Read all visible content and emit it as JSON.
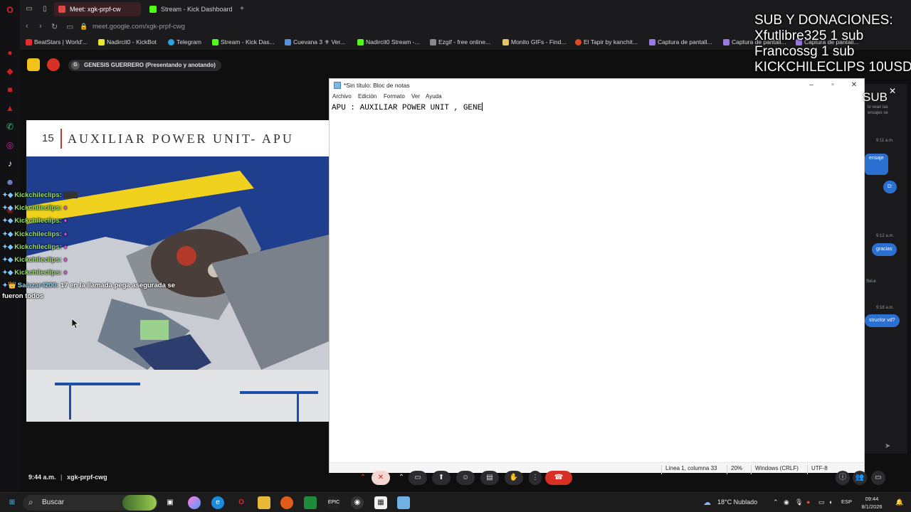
{
  "browser": {
    "tabs": [
      {
        "label": "Meet: xgk-prpf-cw",
        "active": true
      },
      {
        "label": "Stream - Kick Dashboard",
        "active": false
      }
    ],
    "url": "meet.google.com/xgk-prpf-cwg",
    "bookmarks": [
      "BeatStars | World'...",
      "Nadircit0 - KickBot",
      "Telegram",
      "Stream - Kick Das...",
      "Cuevana 3 ⚜ Ver...",
      "Nadircit0 Stream -...",
      "Ezgif - free online...",
      "Monito GIFs - Find...",
      "El Tapir by kanchit...",
      "Captura de pantall...",
      "Captura de pantall...",
      "Captura de pantall..."
    ]
  },
  "meet": {
    "presenting_initial": "G",
    "presenting_label": "GENESIS GUERRERO (Presentando y anotando)",
    "time": "9:44 a.m.",
    "separator": "|",
    "meeting_code": "xgk-prpf-cwg"
  },
  "slide": {
    "number": "15",
    "title": "AUXILIAR POWER UNIT- APU"
  },
  "stream_overlay": {
    "donations_lines": [
      "SUB Y DONACIONES:",
      "Xfutlibre325 1 sub",
      "Francossg 1 sub",
      "KICKCHILECLIPS 10USD"
    ],
    "sub_label": "SUB",
    "chat": [
      {
        "name": "Kickchileclips:",
        "text": ""
      },
      {
        "name": "Kickchileclips:",
        "text": ""
      },
      {
        "name": "Kickchileclips:",
        "text": ""
      },
      {
        "name": "Kickchileclips:",
        "text": ""
      },
      {
        "name": "Kickchileclips:",
        "text": ""
      },
      {
        "name": "Kickchileclips:",
        "text": ""
      },
      {
        "name": "Kickchileclips:",
        "text": ""
      },
      {
        "name": "Salazar4200:",
        "text": "17 en la llamada pega asegurada se"
      }
    ],
    "chat_continuation": "fueron todos"
  },
  "notepad": {
    "title": "*Sin título: Bloc de notas",
    "menu": [
      "Archivo",
      "Edición",
      "Formato",
      "Ver",
      "Ayuda"
    ],
    "content": "APU : AUXILIAR POWER UNIT , GENE",
    "status": {
      "position": "Línea 1, columna 33",
      "zoom": "20%",
      "line_ending": "Windows (CRLF)",
      "encoding": "UTF-8"
    }
  },
  "right_chat": {
    "times": [
      "9:11 a.m.",
      "9:12 a.m.",
      "9:18 a.m."
    ],
    "bubbles": [
      "ensaje",
      "D:",
      "gracias",
      "structor vd?"
    ],
    "snippets": [
      "lo vean las",
      "ensajes se",
      "Sol.e"
    ]
  },
  "taskbar": {
    "search_placeholder": "Buscar",
    "weather": "18°C  Nublado",
    "language": "ESP",
    "time": "09:44",
    "date": "8/1/2026"
  }
}
